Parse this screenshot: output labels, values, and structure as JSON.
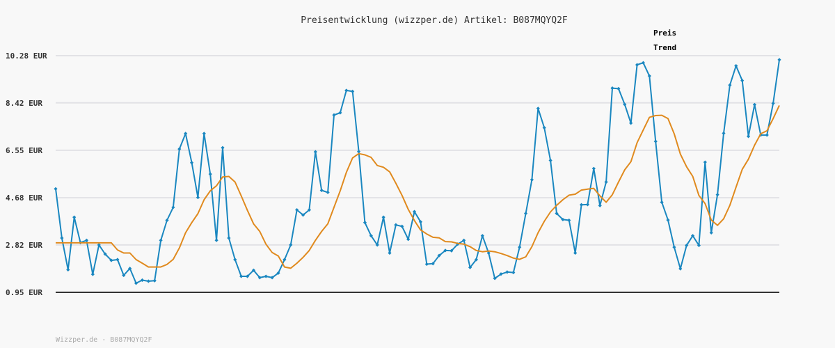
{
  "chart_data": {
    "type": "line",
    "title": "Preisentwicklung (wizzper.de) Artikel: B087MQYQ2F",
    "footer": "Wizzper.de - B087MQYQ2F",
    "legend_position": "top-right",
    "grid": true,
    "ylim": [
      0.95,
      10.28
    ],
    "y_ticks": [
      "10.28 EUR",
      "8.42 EUR",
      "6.55 EUR",
      "4.68 EUR",
      "2.82 EUR",
      "0.95 EUR"
    ],
    "y_tick_values": [
      10.28,
      8.42,
      6.55,
      4.68,
      2.82,
      0.95
    ],
    "series": [
      {
        "name": "Preis",
        "color": "#1a87c0",
        "values": [
          5.03,
          3.09,
          1.84,
          3.91,
          2.91,
          3.0,
          1.66,
          2.82,
          2.46,
          2.21,
          2.24,
          1.62,
          1.89,
          1.31,
          1.43,
          1.39,
          1.41,
          3.0,
          3.79,
          4.3,
          6.6,
          7.21,
          6.06,
          4.69,
          7.21,
          5.61,
          3.0,
          6.65,
          3.09,
          2.24,
          1.58,
          1.58,
          1.82,
          1.53,
          1.58,
          1.53,
          1.71,
          2.24,
          2.82,
          4.2,
          4.0,
          4.2,
          6.49,
          4.97,
          4.89,
          7.94,
          8.03,
          8.91,
          8.87,
          6.5,
          3.7,
          3.18,
          2.82,
          3.91,
          2.5,
          3.61,
          3.55,
          3.04,
          4.13,
          3.73,
          2.06,
          2.08,
          2.4,
          2.6,
          2.59,
          2.85,
          3.0,
          1.93,
          2.24,
          3.18,
          2.5,
          1.5,
          1.67,
          1.75,
          1.73,
          2.73,
          4.06,
          5.39,
          8.2,
          7.44,
          6.15,
          4.06,
          3.82,
          3.79,
          2.5,
          4.4,
          4.41,
          5.83,
          4.37,
          5.3,
          9.0,
          8.98,
          8.36,
          7.62,
          9.92,
          10.0,
          9.48,
          6.9,
          4.5,
          3.8,
          2.73,
          1.88,
          2.8,
          3.18,
          2.8,
          6.08,
          3.3,
          4.8,
          7.22,
          9.12,
          9.88,
          9.3,
          7.1,
          8.35,
          7.15,
          7.15,
          8.4,
          10.12
        ]
      },
      {
        "name": "Trend",
        "color": "#e08a1e",
        "values": [
          2.9,
          2.9,
          2.9,
          2.9,
          2.9,
          2.9,
          2.9,
          2.9,
          2.9,
          2.9,
          2.62,
          2.5,
          2.5,
          2.24,
          2.1,
          1.95,
          1.95,
          1.95,
          2.05,
          2.25,
          2.7,
          3.3,
          3.7,
          4.05,
          4.6,
          4.95,
          5.15,
          5.5,
          5.52,
          5.3,
          4.75,
          4.18,
          3.65,
          3.35,
          2.85,
          2.52,
          2.38,
          1.95,
          1.9,
          2.1,
          2.33,
          2.6,
          3.0,
          3.35,
          3.65,
          4.3,
          4.95,
          5.68,
          6.25,
          6.42,
          6.37,
          6.27,
          5.95,
          5.88,
          5.7,
          5.25,
          4.77,
          4.22,
          3.78,
          3.41,
          3.25,
          3.12,
          3.1,
          2.95,
          2.94,
          2.88,
          2.85,
          2.75,
          2.6,
          2.55,
          2.58,
          2.55,
          2.48,
          2.4,
          2.3,
          2.25,
          2.35,
          2.75,
          3.3,
          3.75,
          4.12,
          4.38,
          4.6,
          4.78,
          4.82,
          4.98,
          5.02,
          5.05,
          4.75,
          4.5,
          4.8,
          5.3,
          5.78,
          6.1,
          6.85,
          7.35,
          7.85,
          7.92,
          7.93,
          7.8,
          7.2,
          6.4,
          5.9,
          5.52,
          4.77,
          4.45,
          3.8,
          3.59,
          3.85,
          4.38,
          5.1,
          5.8,
          6.2,
          6.75,
          7.2,
          7.32,
          7.8,
          8.32
        ]
      }
    ]
  }
}
